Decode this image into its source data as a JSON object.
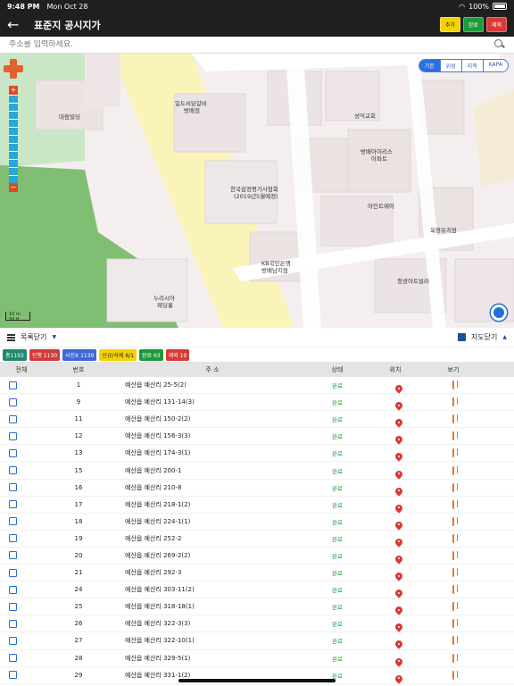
{
  "status_bar": {
    "time": "9:48 PM",
    "date": "Mon Oct 28",
    "battery": "100%"
  },
  "header": {
    "back_label": "←",
    "title": "표준지 공시지가",
    "buttons": {
      "add": "추가",
      "done": "완료",
      "delete": "제외"
    }
  },
  "search": {
    "placeholder": "주소를 입력하세요.",
    "value": ""
  },
  "map": {
    "tabs": [
      "기본",
      "위성",
      "지적",
      "KAPA"
    ],
    "active_tab": "기본",
    "labels": {
      "daerim": "대림빌딩",
      "ildo": "일도씨닭갈비",
      "ildo_sub": "방배점",
      "appraisal": "한국감정평가사협회",
      "appraisal_sub": "(2019년5월예정)",
      "kb": "KB국민은행",
      "kb_sub": "방배남지점",
      "seongyo": "성덕교회",
      "ipark": "방배아이리스",
      "ipark_sub": "아파트",
      "iantwea": "아인트웨어",
      "kinder": "옥영유치원",
      "villa": "청광아트빌라",
      "nurisia": "누리시아",
      "nurisia_sub": "웨딩홀"
    },
    "scale": {
      "top": "10 m",
      "bottom": "50 ft"
    }
  },
  "list_header": {
    "list_toggle": "목록닫기",
    "map_toggle": "지도닫기"
  },
  "badges": [
    "총1193",
    "진행 1130",
    "사진X 1130",
    "신규/삭제 6/1",
    "완료 63",
    "제외 19"
  ],
  "table": {
    "headers": {
      "all": "전체",
      "num": "번호",
      "addr": "주 소",
      "status": "상태",
      "loc": "위치",
      "view": "보기"
    },
    "rows": [
      {
        "num": "1",
        "addr": "예산읍 예산리 25-5(2)",
        "status": "완료"
      },
      {
        "num": "9",
        "addr": "예산읍 예산리 131-14(3)",
        "status": "완료"
      },
      {
        "num": "11",
        "addr": "예산읍 예산리 150-2(2)",
        "status": "완료"
      },
      {
        "num": "12",
        "addr": "예산읍 예산리 156-3(3)",
        "status": "완료"
      },
      {
        "num": "13",
        "addr": "예산읍 예산리 174-3(1)",
        "status": "완료"
      },
      {
        "num": "15",
        "addr": "예산읍 예산리 200-1",
        "status": "완료"
      },
      {
        "num": "16",
        "addr": "예산읍 예산리 210-8",
        "status": "완료"
      },
      {
        "num": "17",
        "addr": "예산읍 예산리 218-1(2)",
        "status": "완료"
      },
      {
        "num": "18",
        "addr": "예산읍 예산리 224-1(1)",
        "status": "완료"
      },
      {
        "num": "19",
        "addr": "예산읍 예산리 252-2",
        "status": "완료"
      },
      {
        "num": "20",
        "addr": "예산읍 예산리 269-2(2)",
        "status": "완료"
      },
      {
        "num": "21",
        "addr": "예산읍 예산리 292-3",
        "status": "완료"
      },
      {
        "num": "24",
        "addr": "예산읍 예산리 303-11(2)",
        "status": "완료"
      },
      {
        "num": "25",
        "addr": "예산읍 예산리 318-18(1)",
        "status": "완료"
      },
      {
        "num": "26",
        "addr": "예산읍 예산리 322-3(3)",
        "status": "완료"
      },
      {
        "num": "27",
        "addr": "예산읍 예산리 322-10(1)",
        "status": "완료"
      },
      {
        "num": "28",
        "addr": "예산읍 예산리 329-5(1)",
        "status": "완료"
      },
      {
        "num": "29",
        "addr": "예산읍 예산리 331-1(2)",
        "status": "완료"
      }
    ]
  }
}
